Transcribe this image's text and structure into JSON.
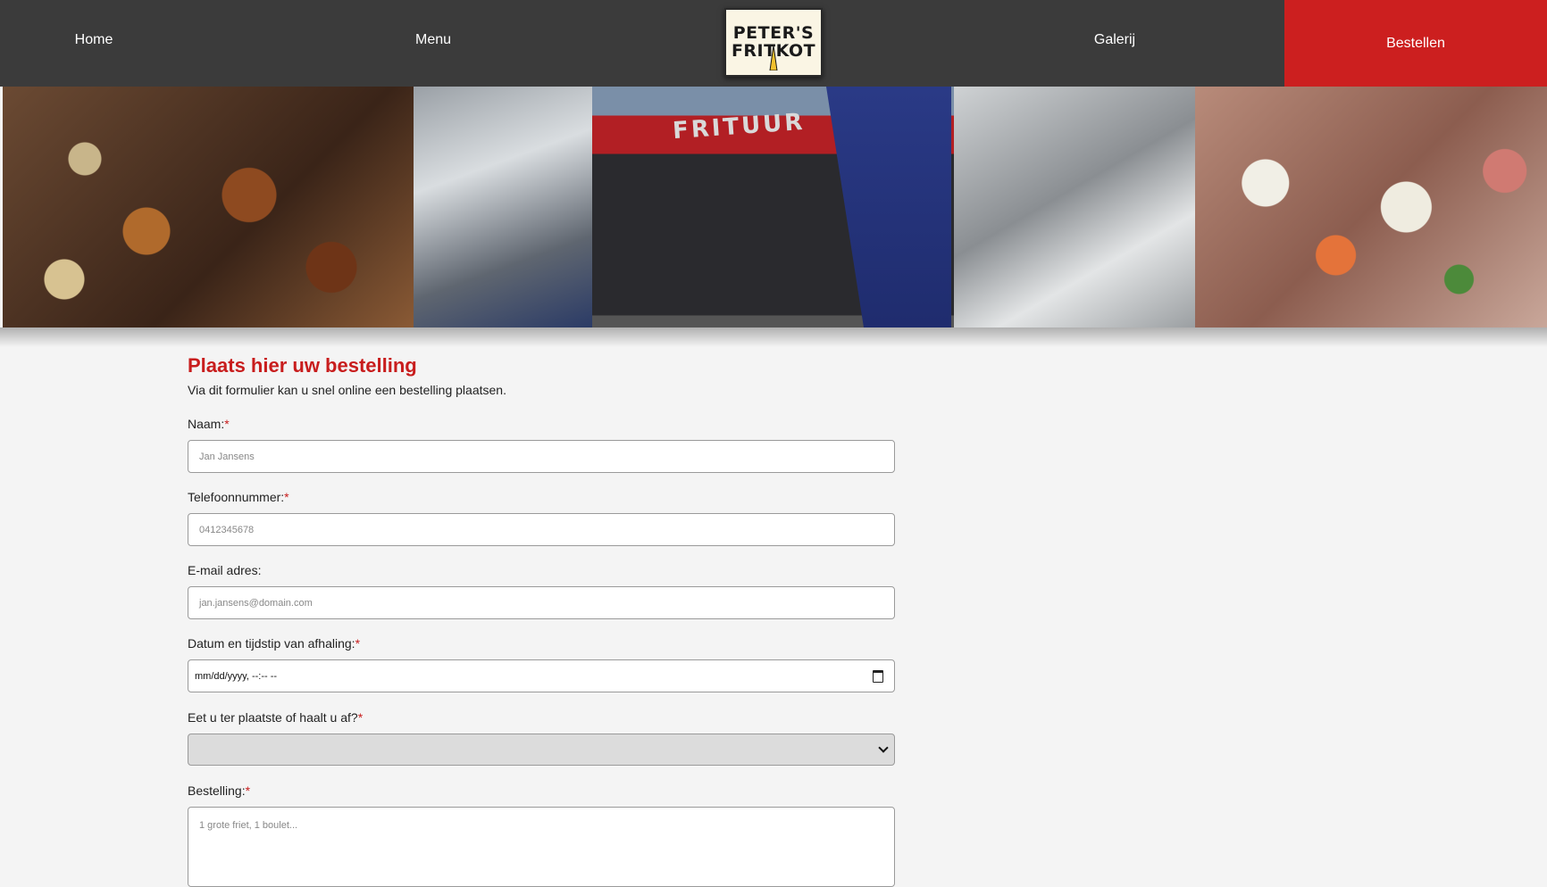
{
  "nav": {
    "home": "Home",
    "menu": "Menu",
    "gallery": "Galerij",
    "order": "Bestellen",
    "logo_line1": "PETER'S",
    "logo_line2": "FRITKOT"
  },
  "banner": {
    "sign_text": "FRITUUR"
  },
  "form": {
    "title": "Plaats hier uw bestelling",
    "subtitle": "Via dit formulier kan u snel online een bestelling plaatsen.",
    "required_mark": "*",
    "name_label": "Naam:",
    "name_placeholder": "Jan Jansens",
    "phone_label": "Telefoonnummer:",
    "phone_placeholder": "0412345678",
    "email_label": "E-mail adres:",
    "email_placeholder": "jan.jansens@domain.com",
    "datetime_label": "Datum en tijdstip van afhaling:",
    "datetime_value": "mm/dd/yyyy, --:-- --",
    "dine_label": "Eet u ter plaatste of haalt u af?",
    "dine_value": "",
    "order_label": "Bestelling:",
    "order_placeholder": "1 grote friet, 1 boulet..."
  },
  "colors": {
    "nav_bg": "#3b3b3b",
    "accent_red": "#cc1f1f",
    "page_bg": "#f4f4f4"
  }
}
